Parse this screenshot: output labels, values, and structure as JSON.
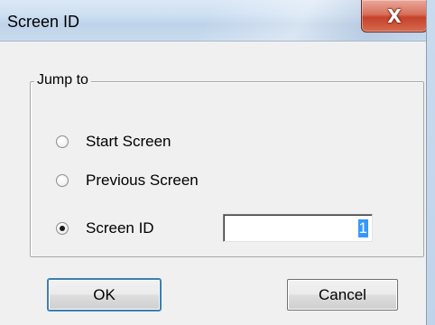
{
  "window": {
    "title": "Screen ID",
    "close_glyph": "X"
  },
  "group": {
    "legend": "Jump to",
    "options": [
      {
        "label": "Start Screen",
        "checked": false
      },
      {
        "label": "Previous Screen",
        "checked": false
      },
      {
        "label": "Screen ID",
        "checked": true
      }
    ]
  },
  "screen_id_input": {
    "value": "1"
  },
  "buttons": {
    "ok_label": "OK",
    "cancel_label": "Cancel"
  },
  "colors": {
    "selection": "#3399ff",
    "close_button": "#c6412a"
  }
}
